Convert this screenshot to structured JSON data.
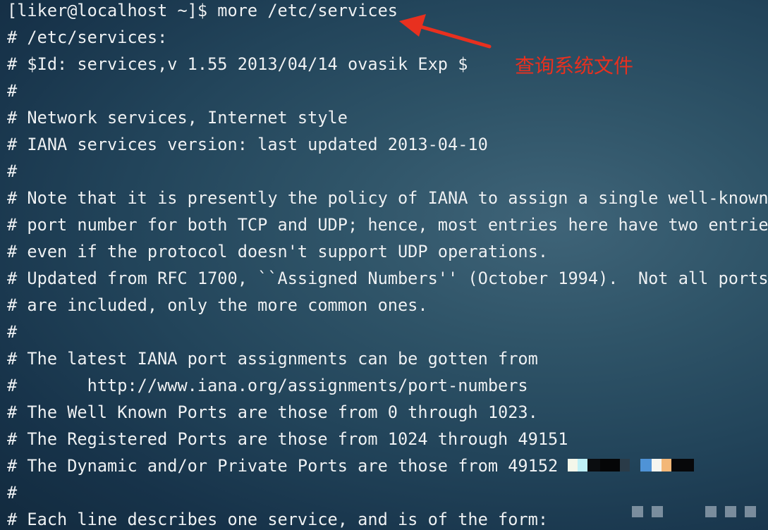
{
  "terminal": {
    "lines": [
      "[liker@localhost ~]$ more /etc/services",
      "# /etc/services:",
      "# $Id: services,v 1.55 2013/04/14 ovasik Exp $",
      "#",
      "# Network services, Internet style",
      "# IANA services version: last updated 2013-04-10",
      "#",
      "# Note that it is presently the policy of IANA to assign a single well-known",
      "# port number for both TCP and UDP; hence, most entries here have two entries",
      "# even if the protocol doesn't support UDP operations.",
      "# Updated from RFC 1700, ``Assigned Numbers'' (October 1994).  Not all ports",
      "# are included, only the more common ones.",
      "#",
      "# The latest IANA port assignments can be gotten from",
      "#       http://www.iana.org/assignments/port-numbers",
      "# The Well Known Ports are those from 0 through 1023.",
      "# The Registered Ports are those from 1024 through 49151",
      "# The Dynamic and/or Private Ports are those from 49152",
      "#",
      "# Each line describes one service, and is of the form:"
    ]
  },
  "annotation": {
    "text": "查询系统文件",
    "color": "#e8301f"
  },
  "colors": {
    "text": "#eef2f5",
    "background": "#22445a"
  }
}
